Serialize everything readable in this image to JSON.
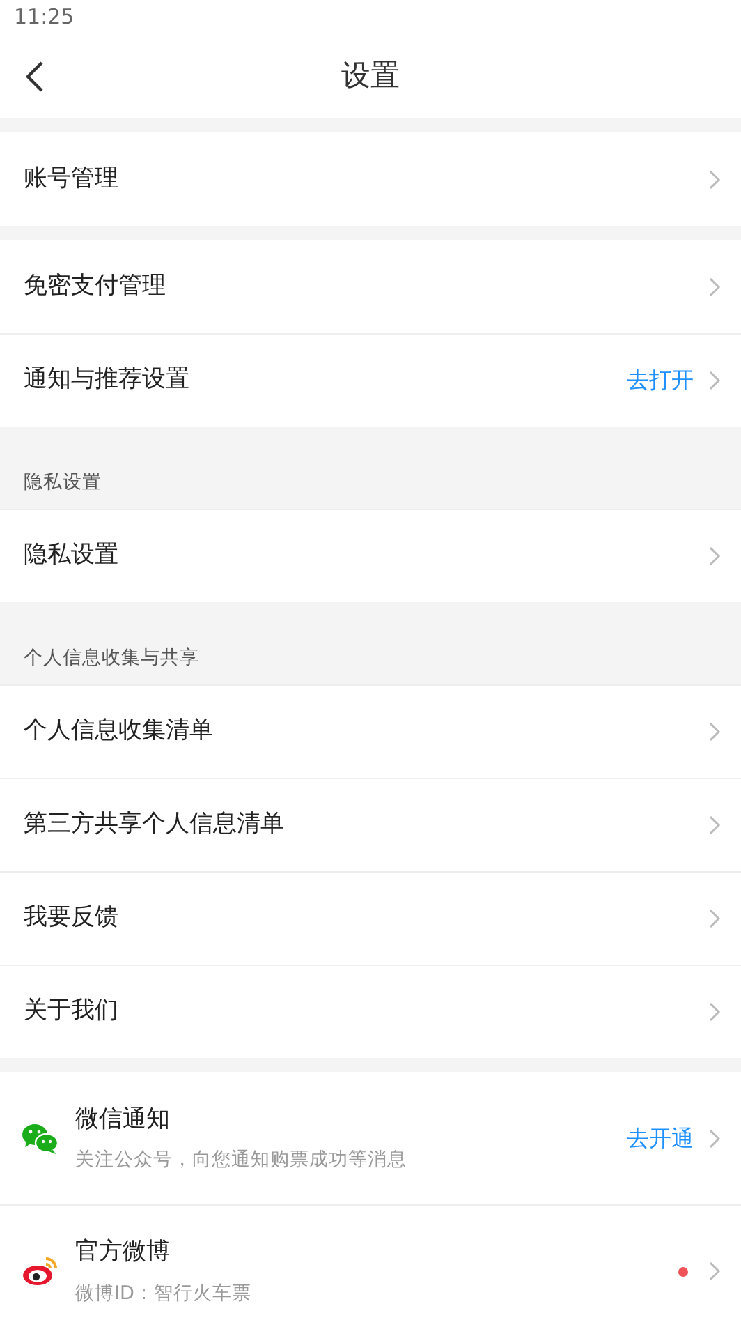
{
  "status_bar": {
    "time": "11:25"
  },
  "header": {
    "title": "设置"
  },
  "sections": [
    {
      "items": [
        {
          "label": "账号管理"
        }
      ]
    },
    {
      "items": [
        {
          "label": "免密支付管理"
        },
        {
          "label": "通知与推荐设置",
          "action": "去打开"
        }
      ]
    },
    {
      "heading": "隐私设置",
      "items": [
        {
          "label": "隐私设置"
        }
      ]
    },
    {
      "heading": "个人信息收集与共享",
      "items": [
        {
          "label": "个人信息收集清单"
        },
        {
          "label": "第三方共享个人信息清单"
        },
        {
          "label": "我要反馈"
        },
        {
          "label": "关于我们"
        }
      ]
    },
    {
      "items": [
        {
          "kind": "wechat",
          "label": "微信通知",
          "subtitle": "关注公众号，向您通知购票成功等消息",
          "action": "去开通",
          "unread": false
        },
        {
          "kind": "weibo",
          "label": "官方微博",
          "subtitle": "微博ID：智行火车票",
          "unread": true
        }
      ]
    }
  ]
}
